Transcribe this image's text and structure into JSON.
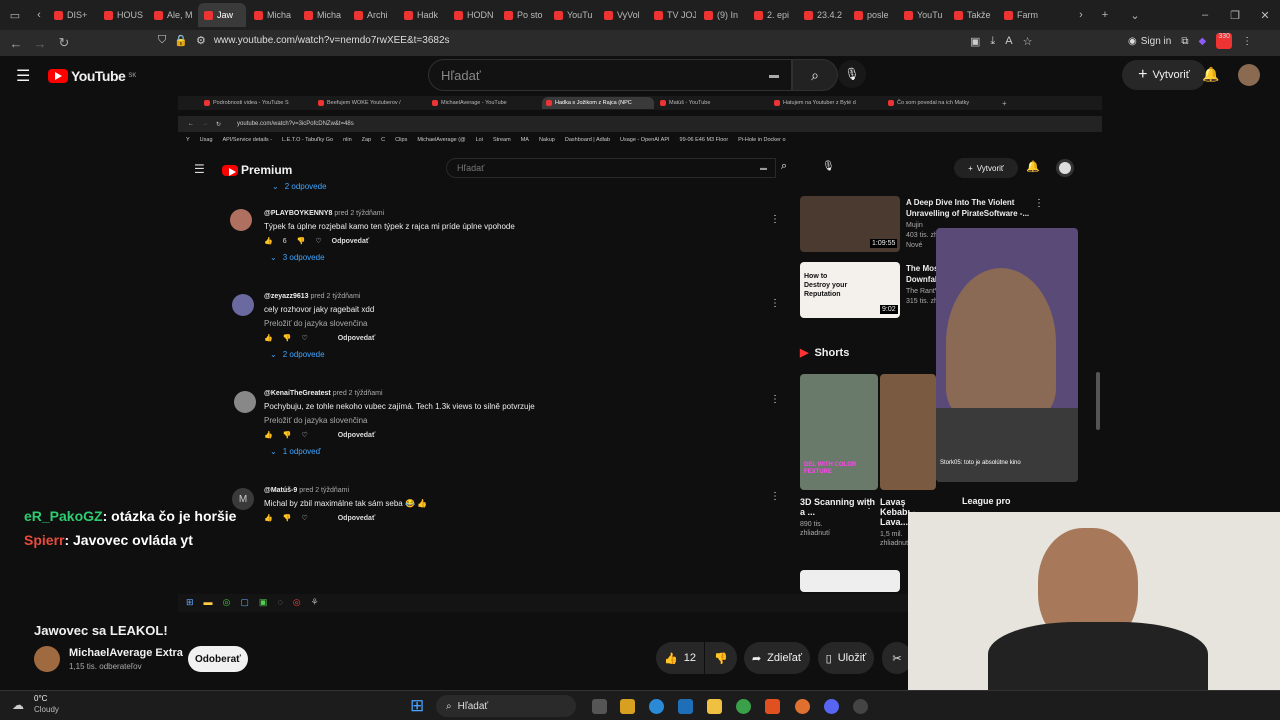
{
  "outer_tabs": [
    {
      "label": "DIS+"
    },
    {
      "label": "HOUS"
    },
    {
      "label": "Ale, M"
    },
    {
      "label": "Jaw",
      "active": true
    },
    {
      "label": "Micha"
    },
    {
      "label": "Micha"
    },
    {
      "label": "Archi"
    },
    {
      "label": "Hadk"
    },
    {
      "label": "HODN"
    },
    {
      "label": "Po sto"
    },
    {
      "label": "YouTu"
    },
    {
      "label": "VyVol"
    },
    {
      "label": "TV JOJ"
    },
    {
      "label": "(9) In"
    },
    {
      "label": "2. epi"
    },
    {
      "label": "23.4.2"
    },
    {
      "label": "posle"
    },
    {
      "label": "YouTu"
    },
    {
      "label": "Takže"
    },
    {
      "label": "Farm"
    }
  ],
  "outer_url": "www.youtube.com/watch?v=nemdo7rwXEE&t=3682s",
  "outer_sign_in": "Sign in",
  "outer_badge": "330",
  "yt": {
    "logo": "YouTube",
    "country": "SK",
    "search_placeholder": "Hľadať",
    "create": "Vytvoriť"
  },
  "inner": {
    "tabs": [
      {
        "label": "Podrobnosti videa - YouTube S"
      },
      {
        "label": "Beefujem WOKE Youtuberov /"
      },
      {
        "label": "MichaelAverage - YouTube"
      },
      {
        "label": "Hadka s Jožikom z Rajca (NPC",
        "active": true
      },
      {
        "label": "Matúš - YouTube"
      },
      {
        "label": "Hatujem na Youtuber z Byté d"
      },
      {
        "label": "Čo som povedal na ich Matky"
      }
    ],
    "url": "youtube.com/watch?v=3icPofcDNZw&t=48s",
    "bookmarks": [
      "Y",
      "Usag",
      "API/Service details -",
      "L.E.T.O - Tabuľky Go",
      "nlin",
      "Zap",
      "C",
      "Clips",
      "MichaelAverage (@",
      "Loi",
      "Stream",
      "MA",
      "Nakup",
      "Dashboard | Adlab",
      "Usage - OpenAI API",
      "99-06 E46 M3 Floor",
      "Pi-Hole in Docker o"
    ],
    "logo": "Premium",
    "search_placeholder": "Hľadať",
    "create": "Vytvoriť"
  },
  "comments": [
    {
      "replies": "2 odpovede"
    },
    {
      "author": "@PLAYBOYKENNY8",
      "time": "pred 2 týždňami",
      "text": "Týpek fa úplne rozjebal kamo ten týpek z rajca mi príde úplne vpohode",
      "likes": "6",
      "reply": "Odpovedať",
      "replies": "3 odpovede"
    },
    {
      "author": "@zeyazz9613",
      "time": "pred 2 týždňami",
      "text": "cely rozhovor jaky ragebait xdd",
      "translate": "Preložiť do jazyka slovenčina",
      "reply": "Odpovedať",
      "replies": "2 odpovede"
    },
    {
      "author": "@KenaiTheGreatest",
      "time": "pred 2 týždňami",
      "text": "Pochybuju, ze tohle nekoho vubec zajímá. Tech 1.3k views to silně potvrzuje",
      "translate": "Preložiť do jazyka slovenčina",
      "reply": "Odpovedať",
      "replies": "1 odpoveď"
    },
    {
      "author": "@Matúš-9",
      "avatar_letter": "M",
      "time": "pred 2 týždňami",
      "text": "Michal by zbil maximálne tak sám seba 😂 👍",
      "reply": "Odpovedať"
    }
  ],
  "sidebar": {
    "videos": [
      {
        "title": "A Deep Dive Into The Violent Unravelling of PirateSoftware -...",
        "channel": "Mujin",
        "meta": "403 tis. zh",
        "badge": "Nové",
        "duration": "1:09:55"
      },
      {
        "title": "The Mos Downfal",
        "channel": "The RantV",
        "meta": "315 tis. zh",
        "thumb_text": "How to Destroy your Reputation",
        "duration": "9:02"
      }
    ],
    "shorts_title": "Shorts",
    "shorts": [
      {
        "title": "3D Scanning with a ...",
        "views": "890 tis. zhliadnutí",
        "thumb_text": "DEL WITH COLOR FEXTURE"
      },
      {
        "title": "Lavaş Kebabı - Lava...",
        "views": "1,5 mil. zhliadnutí"
      },
      {
        "title": "League pro"
      }
    ]
  },
  "webcam_caption": "Stork05: toto je absolútne kino",
  "chat": [
    {
      "user": "eR_PakoGZ",
      "message": ": otázka čo je horšie",
      "color": "#2ecc71"
    },
    {
      "user": "Spierr",
      "message": ": Javovec ovláda yt",
      "color": "#e74c3c"
    }
  ],
  "video_info": {
    "title": "Jawovec sa LEAKOL!",
    "channel": "MichaelAverage Extra",
    "subscribers": "1,15 tis. odberateľov",
    "subscribe": "Odoberať",
    "likes": "12",
    "share": "Zdieľať",
    "save": "Uložiť"
  },
  "taskbar": {
    "weather_temp": "0°C",
    "weather_desc": "Cloudy",
    "search": "Hľadať"
  }
}
